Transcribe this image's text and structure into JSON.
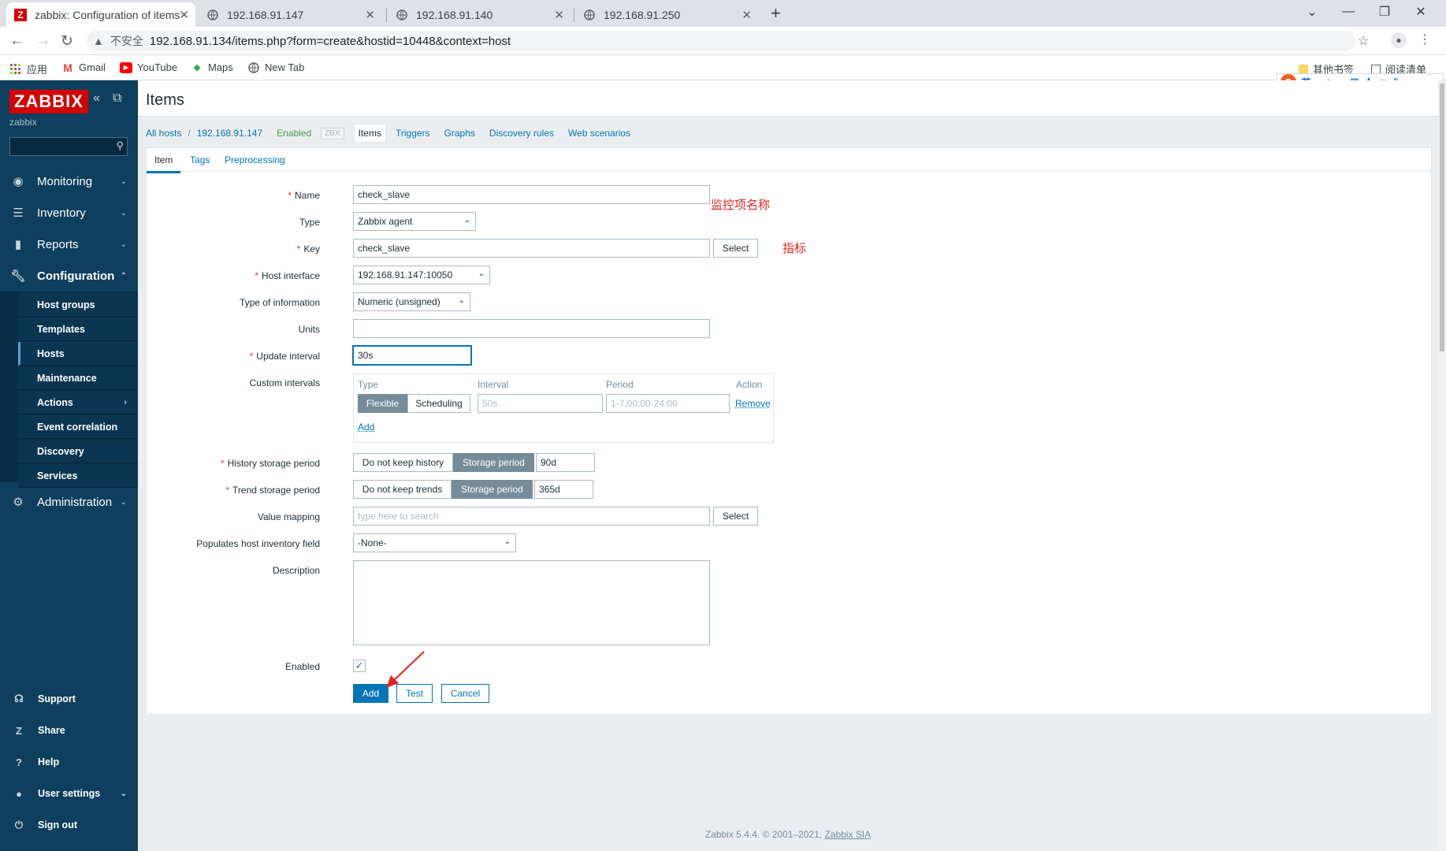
{
  "browser": {
    "tabs": [
      {
        "title": "zabbix: Configuration of items",
        "active": true
      },
      {
        "title": "192.168.91.147"
      },
      {
        "title": "192.168.91.140"
      },
      {
        "title": "192.168.91.250"
      }
    ],
    "new_tab": "+",
    "window_controls": {
      "dropdown": "⌄",
      "minimize": "—",
      "restore": "❐",
      "close": "✕"
    },
    "security_label": "不安全",
    "url": "192.168.91.134/items.php?form=create&hostid=10448&context=host",
    "bookmarks": [
      {
        "label": "应用",
        "icon": "apps-grid-icon"
      },
      {
        "label": "Gmail",
        "icon": "gmail-icon"
      },
      {
        "label": "YouTube",
        "icon": "youtube-icon"
      },
      {
        "label": "Maps",
        "icon": "maps-icon"
      },
      {
        "label": "New Tab",
        "icon": "globe-icon"
      }
    ],
    "other_bookmarks": "其他书签",
    "reading_list": "阅读清单",
    "ime_lang": "英"
  },
  "sidebar": {
    "logo": "ZABBIX",
    "server_name": "zabbix",
    "search_placeholder": "",
    "menu": [
      {
        "label": "Monitoring",
        "icon": "eye-icon"
      },
      {
        "label": "Inventory",
        "icon": "list-icon"
      },
      {
        "label": "Reports",
        "icon": "bar-chart-icon"
      },
      {
        "label": "Configuration",
        "icon": "wrench-icon"
      },
      {
        "label": "Administration",
        "icon": "gear-icon"
      }
    ],
    "config_submenu": [
      "Host groups",
      "Templates",
      "Hosts",
      "Maintenance",
      "Actions",
      "Event correlation",
      "Discovery",
      "Services"
    ],
    "bottom": [
      {
        "label": "Support",
        "icon": "headset-icon"
      },
      {
        "label": "Share",
        "icon": "share-icon"
      },
      {
        "label": "Help",
        "icon": "help-icon"
      },
      {
        "label": "User settings",
        "icon": "user-icon"
      },
      {
        "label": "Sign out",
        "icon": "power-icon"
      }
    ]
  },
  "page": {
    "title": "Items",
    "hostnav": {
      "all_hosts": "All hosts",
      "sep": "/",
      "host": "192.168.91.147",
      "status": "Enabled",
      "zbx": "ZBX",
      "items": "Items",
      "triggers": "Triggers",
      "graphs": "Graphs",
      "discovery_rules": "Discovery rules",
      "web_scenarios": "Web scenarios"
    },
    "form_tabs": [
      "Item",
      "Tags",
      "Preprocessing"
    ],
    "form": {
      "name_label": "Name",
      "name_value": "check_slave",
      "type_label": "Type",
      "type_value": "Zabbix agent",
      "key_label": "Key",
      "key_value": "check_slave",
      "key_select": "Select",
      "host_interface_label": "Host interface",
      "host_interface_value": "192.168.91.147:10050",
      "type_of_info_label": "Type of information",
      "type_of_info_value": "Numeric (unsigned)",
      "units_label": "Units",
      "units_value": "",
      "update_interval_label": "Update interval",
      "update_interval_value": "30s",
      "custom_intervals_label": "Custom intervals",
      "ci_headers": {
        "type": "Type",
        "interval": "Interval",
        "period": "Period",
        "action": "Action"
      },
      "ci_flexible": "Flexible",
      "ci_scheduling": "Scheduling",
      "ci_interval_placeholder": "50s",
      "ci_period_placeholder": "1-7,00:00-24:00",
      "ci_remove": "Remove",
      "ci_add": "Add",
      "history_label": "History storage period",
      "history_no_keep": "Do not keep history",
      "history_storage": "Storage period",
      "history_value": "90d",
      "trend_label": "Trend storage period",
      "trend_no_keep": "Do not keep trends",
      "trend_storage": "Storage period",
      "trend_value": "365d",
      "value_mapping_label": "Value mapping",
      "value_mapping_placeholder": "type here to search",
      "value_mapping_select": "Select",
      "inventory_label": "Populates host inventory field",
      "inventory_value": "-None-",
      "description_label": "Description",
      "description_value": "",
      "enabled_label": "Enabled",
      "enabled_checked": true,
      "btn_add": "Add",
      "btn_test": "Test",
      "btn_cancel": "Cancel"
    },
    "annotations": {
      "name_note": "监控项名称",
      "key_note": "指标"
    }
  },
  "footer": {
    "text": "Zabbix 5.4.4. © 2001–2021, ",
    "company": "Zabbix SIA"
  }
}
